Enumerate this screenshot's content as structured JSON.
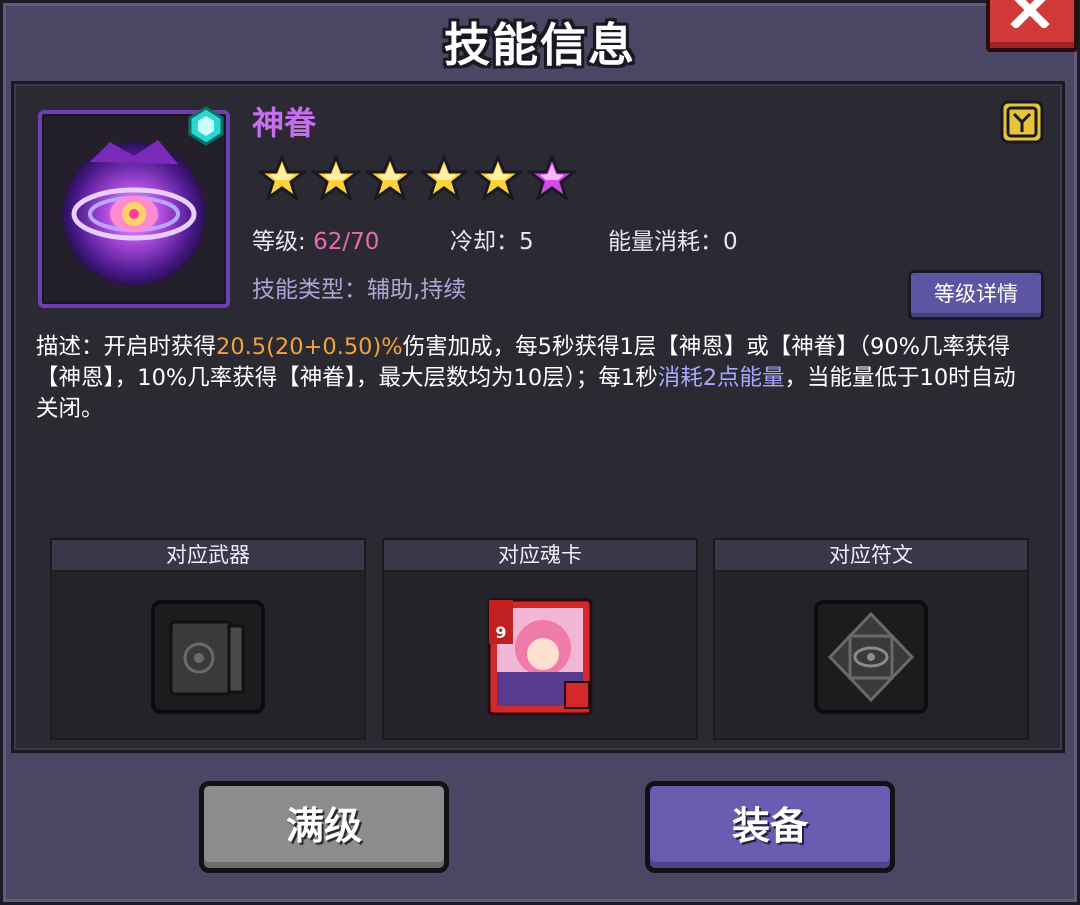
{
  "window": {
    "title": "技能信息"
  },
  "skill": {
    "name": "神眷",
    "stars_total": 6,
    "stars_gold": 5,
    "stars_purple": 1,
    "level_label": "等级: ",
    "level_value": "62/70",
    "cooldown_label": "冷却：",
    "cooldown_value": "5",
    "energy_label": "能量消耗：",
    "energy_value": "0",
    "type_label": "技能类型：",
    "type_value": "辅助,持续"
  },
  "buttons": {
    "detail": "等级详情",
    "max_level": "满级",
    "equip": "装备"
  },
  "description": {
    "p1": "描述：开启时获得",
    "h1": "20.5(20+0.50)%",
    "p2": "伤害加成，每5秒获得1层【神恩】或【神眷】（90%几率获得【神恩】，10%几率获得【神眷】，最大层数均为10层）；每1秒",
    "h2": "消耗2点能量",
    "p3": "，当能量低于10时自动关闭。"
  },
  "slots": [
    {
      "title": "对应武器",
      "icon": "book-icon"
    },
    {
      "title": "对应魂卡",
      "icon": "card-icon",
      "card_value": "9"
    },
    {
      "title": "对应符文",
      "icon": "rune-diamond-icon"
    }
  ],
  "colors": {
    "skill_name": "#c86cf0",
    "level_value": "#e76ab6",
    "highlight_orange": "#f0a23c",
    "highlight_blue": "#a9a6ff",
    "equip_button": "#6a5cb0",
    "max_button": "#8c8c8e",
    "close_button": "#d23a3a"
  }
}
